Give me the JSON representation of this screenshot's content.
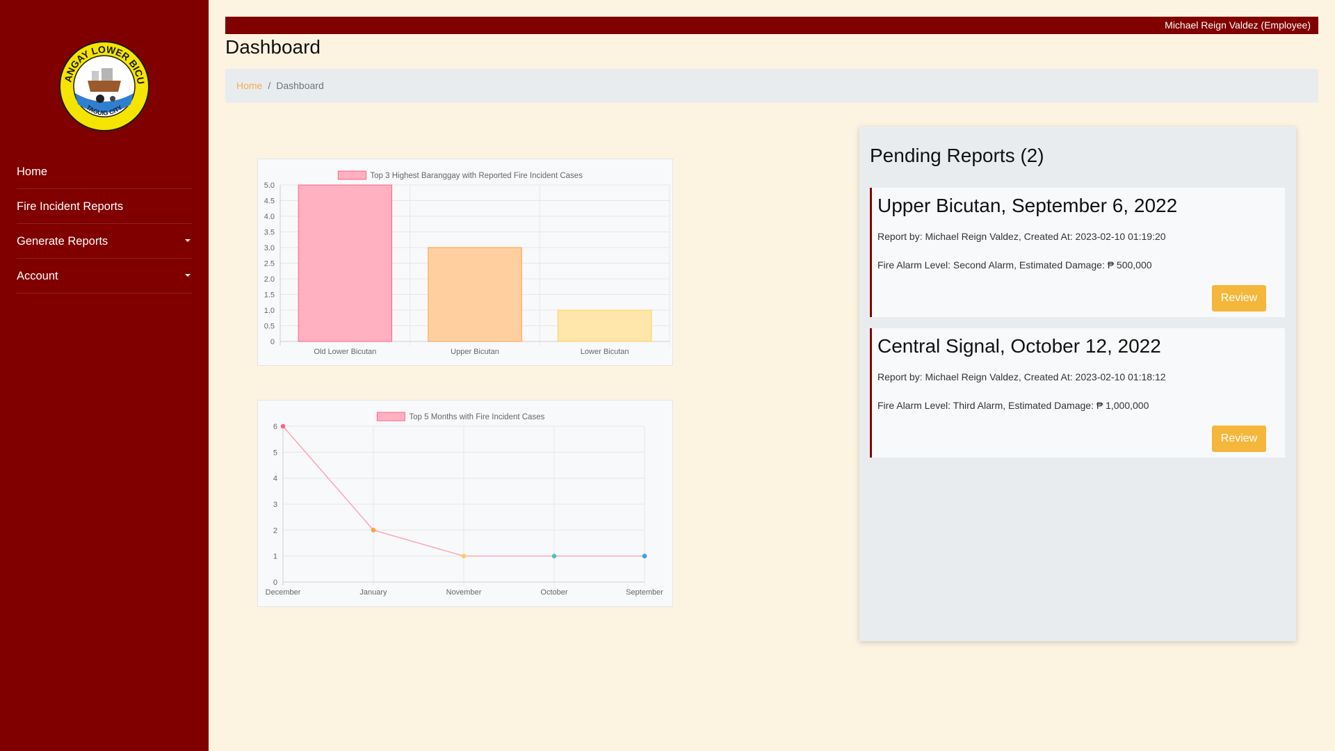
{
  "brand": {
    "logo_icon": "barangay-seal-icon",
    "seal_text_top": "BARANGAY LOWER BICUTAN",
    "seal_text_bottom": "TAGUIG CITY"
  },
  "sidebar": {
    "items": [
      {
        "label": "Home"
      },
      {
        "label": "Fire Incident Reports"
      },
      {
        "label": "Generate Reports"
      },
      {
        "label": "Account"
      }
    ]
  },
  "header": {
    "user": "Michael Reign Valdez (Employee)",
    "title": "Dashboard"
  },
  "breadcrumb": {
    "home": "Home",
    "separator": "/",
    "current": "Dashboard"
  },
  "chart_data": [
    {
      "type": "bar",
      "title": "",
      "legend": "Top 3 Highest Baranggay with Reported Fire Incident Cases",
      "legend_placement": "top",
      "categories": [
        "Old Lower Bicutan",
        "Upper Bicutan",
        "Lower Bicutan"
      ],
      "values": [
        5,
        3,
        1
      ],
      "colors": [
        "#ffb0c1",
        "#ffcf9f",
        "#ffe6aa"
      ],
      "border_colors": [
        "#ff6384",
        "#ff9f40",
        "#ffcd56"
      ],
      "ylim": [
        0,
        5
      ],
      "yticks": [
        "0",
        "0.5",
        "1.0",
        "1.5",
        "2.0",
        "2.5",
        "3.0",
        "3.5",
        "4.0",
        "4.5",
        "5.0"
      ],
      "grid": true
    },
    {
      "type": "line",
      "title": "",
      "legend": "Top 5 Months with Fire Incident Cases",
      "legend_placement": "top",
      "categories": [
        "December",
        "January",
        "November",
        "October",
        "September"
      ],
      "values": [
        6,
        2,
        1,
        1,
        1
      ],
      "line_color": "#ff6384",
      "point_colors": [
        "#ff6384",
        "#ff9f40",
        "#ffcd56",
        "#4bc0c0",
        "#36a2eb"
      ],
      "ylim": [
        0,
        6
      ],
      "yticks": [
        "0",
        "1",
        "2",
        "3",
        "4",
        "5",
        "6"
      ],
      "grid": true
    }
  ],
  "pending": {
    "heading": "Pending Reports (2)",
    "reports": [
      {
        "title": "Upper Bicutan, September 6, 2022",
        "meta": "Report by: Michael Reign Valdez, Created At: 2023-02-10 01:19:20",
        "details": "Fire Alarm Level: Second Alarm, Estimated Damage: ₱ 500,000",
        "button": "Review"
      },
      {
        "title": "Central Signal, October 12, 2022",
        "meta": "Report by: Michael Reign Valdez, Created At: 2023-02-10 01:18:12",
        "details": "Fire Alarm Level: Third Alarm, Estimated Damage: ₱ 1,000,000",
        "button": "Review"
      }
    ]
  },
  "colors": {
    "sidebar": "#800000",
    "background": "#fdf3e1",
    "accent": "#f4b73b",
    "panel": "#e9ecef"
  }
}
